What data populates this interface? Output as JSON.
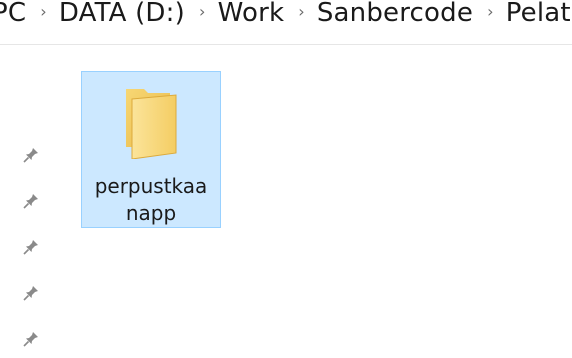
{
  "breadcrumb": {
    "items": [
      "PC",
      "DATA (D:)",
      "Work",
      "Sanbercode",
      "Pelatihan"
    ],
    "separator": "›"
  },
  "folder": {
    "name": "perpustkaanapp",
    "icon": "folder-icon",
    "selected": true,
    "colors": {
      "selection_bg": "#cce8ff",
      "selection_border": "#99d1ff"
    }
  },
  "quick_access": {
    "pin_count": 5,
    "icon": "pin-icon"
  }
}
